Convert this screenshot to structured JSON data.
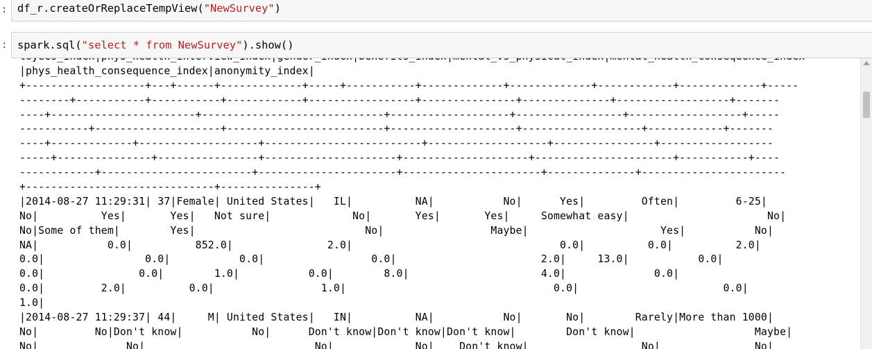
{
  "cells": [
    {
      "prompt": ":",
      "code_prefix": "df_r.createOrReplaceTempView(",
      "code_string": "\"NewSurvey\"",
      "code_suffix": ")"
    },
    {
      "prompt": ":",
      "code_prefix": "spark.sql(",
      "code_string": "\"select * from NewSurvey\"",
      "code_suffix": ").show()"
    }
  ],
  "output_lines": [
    "loyees_index|phys_health_interview_index|gender_index|benefits_index|mental_vs_physical_index|mental_health_consequence_index",
    "|phys_health_consequence_index|anonymity_index|",
    "+-------------------+---+------+-------------+-----+-----------+-------------+-------------+------------+-------------+-----",
    "--------+-----------+-----------+------------+-----------------+---------------+--------------+------------------+-------",
    "----+-----------------------+-----------------------------+-------------------+-----------------+------------------+-----",
    "-----------+--------------------+-------------------------+--------------------+-------------------+------------+-------",
    "----+-------------+-------------------+-------------------------+-------------------+----------------+------------------",
    "-----+---------------+----------------+---------------------+--------------------+----------------------+-----------+----",
    "------------+------------------------+----------------------+----------------------+--------------+-----------------------",
    "+------------------------------+---------------+",
    "|2014-08-27 11:29:31| 37|Female| United States|   IL|          NA|           No|      Yes|         Often|         6-25|",
    "No|          Yes|       Yes|   Not sure|             No|       Yes|       Yes|     Somewhat easy|                      No|",
    "No|Some of them|        Yes|                           No|                 Maybe|                     Yes|           No|",
    "NA|           0.0|          852.0|               2.0|                                 0.0|          0.0|          2.0|",
    "0.0|                0.0|           0.0|                 0.0|                       2.0|     13.0|           0.0|",
    "0.0|               0.0|        1.0|           0.0|        8.0|                     4.0|              0.0|",
    "0.0|         2.0|          0.0|                 1.0|                                 0.0|                       0.0|",
    "1.0|",
    "|2014-08-27 11:29:37| 44|     M| United States|   IN|          NA|           No|       No|        Rarely|More than 1000|",
    "No|         No|Don't know|           No|      Don't know|Don't know|Don't know|        Don't know|                   Maybe|",
    "No|              No|                           No|             No|    Don't know|                  No|               No|"
  ],
  "scrollbar": {
    "thumb_color": "#c1c1c1",
    "track_color": "#f1f1f1"
  },
  "colors": {
    "string_literal": "#ba2121",
    "cell_background": "#f7f7f7",
    "cell_border": "#cfcfcf"
  }
}
